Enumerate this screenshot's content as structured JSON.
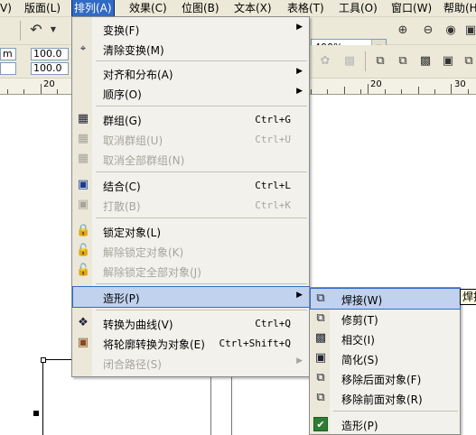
{
  "menubar": {
    "items": [
      {
        "label": "视图(V)",
        "visible_text": "V)"
      },
      {
        "label": "版面(L)"
      },
      {
        "label": "排列(A)"
      },
      {
        "label": "效果(C)"
      },
      {
        "label": "位图(B)"
      },
      {
        "label": "文本(X)"
      },
      {
        "label": "表格(T)"
      },
      {
        "label": "工具(O)"
      },
      {
        "label": "窗口(W)"
      },
      {
        "label": "帮助(H)"
      }
    ],
    "active_index": 2
  },
  "toolbar": {
    "zoom_value": "400%",
    "field_a": "m",
    "field_b": "",
    "scale_x": "100.0",
    "scale_y": "100.0"
  },
  "ruler": {
    "labels": [
      "20",
      "20",
      "30"
    ]
  },
  "main_menu": {
    "items": [
      {
        "label": "变换(F)",
        "shortcut": "",
        "has_submenu": true,
        "disabled": false
      },
      {
        "label": "清除变换(M)",
        "shortcut": "",
        "has_submenu": false,
        "disabled": false
      },
      {
        "label": "对齐和分布(A)",
        "shortcut": "",
        "has_submenu": true,
        "disabled": false
      },
      {
        "label": "顺序(O)",
        "shortcut": "",
        "has_submenu": true,
        "disabled": false
      },
      {
        "label": "群组(G)",
        "shortcut": "Ctrl+G",
        "has_submenu": false,
        "disabled": false
      },
      {
        "label": "取消群组(U)",
        "shortcut": "Ctrl+U",
        "has_submenu": false,
        "disabled": true
      },
      {
        "label": "取消全部群组(N)",
        "shortcut": "",
        "has_submenu": false,
        "disabled": true
      },
      {
        "label": "结合(C)",
        "shortcut": "Ctrl+L",
        "has_submenu": false,
        "disabled": false
      },
      {
        "label": "打散(B)",
        "shortcut": "Ctrl+K",
        "has_submenu": false,
        "disabled": true
      },
      {
        "label": "锁定对象(L)",
        "shortcut": "",
        "has_submenu": false,
        "disabled": false
      },
      {
        "label": "解除锁定对象(K)",
        "shortcut": "",
        "has_submenu": false,
        "disabled": true
      },
      {
        "label": "解除锁定全部对象(J)",
        "shortcut": "",
        "has_submenu": false,
        "disabled": true
      },
      {
        "label": "造形(P)",
        "shortcut": "",
        "has_submenu": true,
        "disabled": false,
        "highlighted": true
      },
      {
        "label": "转换为曲线(V)",
        "shortcut": "Ctrl+Q",
        "has_submenu": false,
        "disabled": false
      },
      {
        "label": "将轮廓转换为对象(E)",
        "shortcut": "Ctrl+Shift+Q",
        "has_submenu": false,
        "disabled": false
      },
      {
        "label": "闭合路径(S)",
        "shortcut": "",
        "has_submenu": true,
        "disabled": true
      }
    ]
  },
  "sub_menu": {
    "items": [
      {
        "label": "焊接(W)",
        "highlighted": true
      },
      {
        "label": "修剪(T)"
      },
      {
        "label": "相交(I)"
      },
      {
        "label": "简化(S)"
      },
      {
        "label": "移除后面对象(F)"
      },
      {
        "label": "移除前面对象(R)"
      },
      {
        "label": "造形(P)",
        "checked": true
      }
    ]
  },
  "tooltip": {
    "text": "焊接"
  },
  "icons": {
    "transform": "transform-icon",
    "group": "group-icon",
    "ungroup": "ungroup-icon",
    "combine": "combine-icon",
    "break_apart": "break-apart-icon",
    "lock": "lock-icon",
    "unlock": "unlock-icon",
    "convert_curve": "convert-curve-icon",
    "outline_to_object": "outline-to-object-icon"
  },
  "colors": {
    "highlight": "#c1d2ee",
    "menubar_active": "#316ac5",
    "chrome": "#ece9d8"
  }
}
